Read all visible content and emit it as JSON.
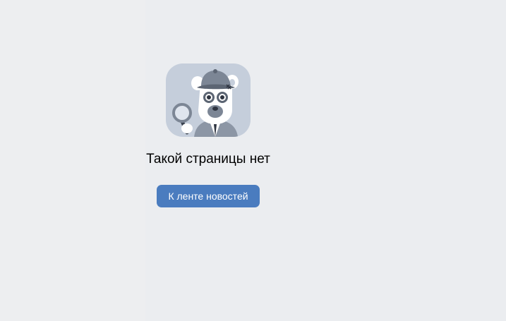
{
  "error_page": {
    "illustration_icon": "detective-bear-magnifier-icon",
    "title": "Такой страницы нет",
    "news_feed_button_label": "К ленте новостей"
  },
  "colors": {
    "page_background": "#edeef0",
    "illustration_background": "#c5cedb",
    "button_background": "#4a7cbf",
    "button_text": "#ffffff",
    "title_text": "#000000"
  }
}
